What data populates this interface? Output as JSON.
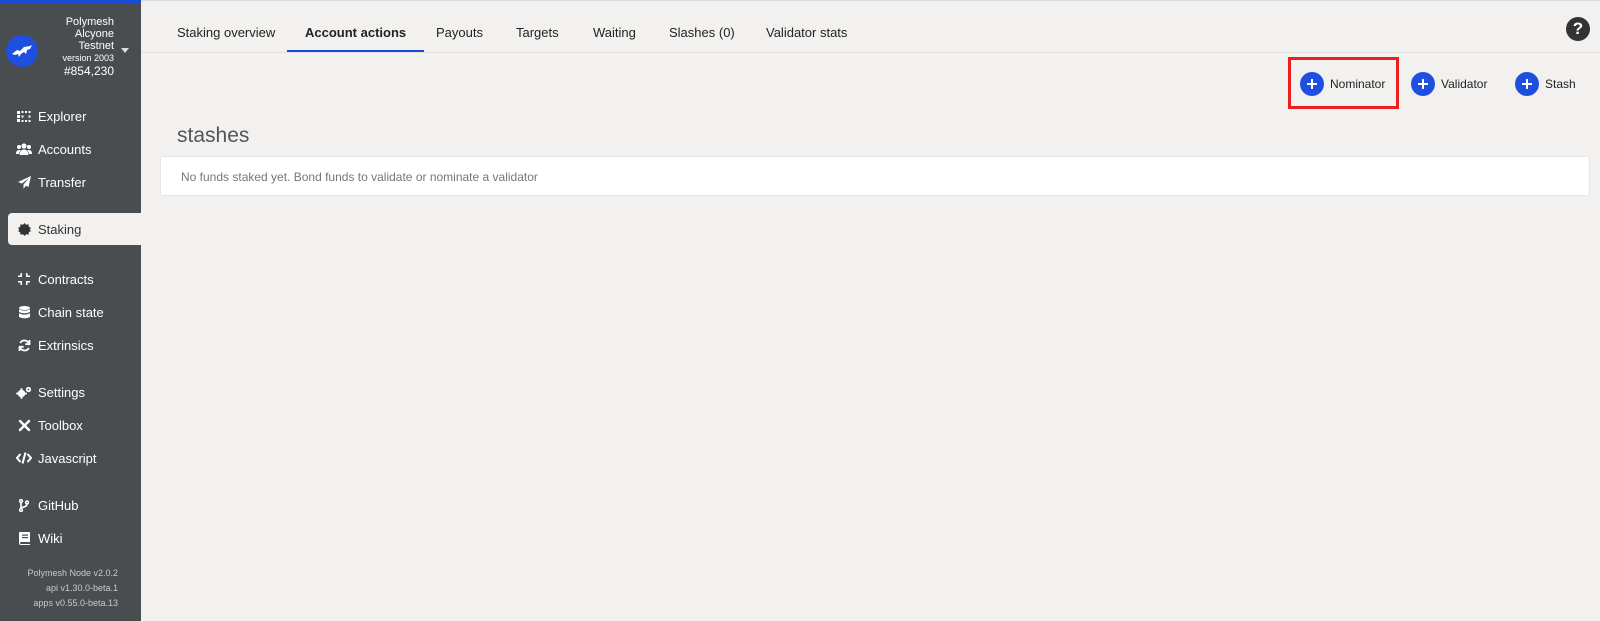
{
  "chain": {
    "name_line1": "Polymesh",
    "name_line2": "Alcyone",
    "name_line3": "Testnet",
    "version": "version 2003",
    "block": "#854,230"
  },
  "sidebar": {
    "items": [
      {
        "label": "Explorer",
        "icon": "explorer-grid-icon"
      },
      {
        "label": "Accounts",
        "icon": "users-icon"
      },
      {
        "label": "Transfer",
        "icon": "paper-plane-icon"
      },
      {
        "label": "Staking",
        "icon": "certificate-icon",
        "active": true
      },
      {
        "label": "Contracts",
        "icon": "compress-icon"
      },
      {
        "label": "Chain state",
        "icon": "database-icon"
      },
      {
        "label": "Extrinsics",
        "icon": "sync-icon"
      },
      {
        "label": "Settings",
        "icon": "cogs-icon"
      },
      {
        "label": "Toolbox",
        "icon": "tools-icon"
      },
      {
        "label": "Javascript",
        "icon": "code-icon"
      },
      {
        "label": "GitHub",
        "icon": "code-branch-icon"
      },
      {
        "label": "Wiki",
        "icon": "book-icon"
      }
    ],
    "footer": {
      "node": "Polymesh Node v2.0.2",
      "api": "api v1.30.0-beta.1",
      "apps": "apps v0.55.0-beta.13"
    }
  },
  "tabs": [
    {
      "label": "Staking overview"
    },
    {
      "label": "Account actions",
      "active": true
    },
    {
      "label": "Payouts"
    },
    {
      "label": "Targets"
    },
    {
      "label": "Waiting"
    },
    {
      "label": "Slashes (0)"
    },
    {
      "label": "Validator stats"
    }
  ],
  "help": {
    "icon": "question-circle-icon",
    "glyph": "?"
  },
  "actions": {
    "nominator": "Nominator",
    "validator": "Validator",
    "stash": "Stash"
  },
  "content": {
    "section_title": "stashes",
    "empty_message": "No funds staked yet. Bond funds to validate or nominate a validator"
  },
  "colors": {
    "accent": "#1f4fdf",
    "sidebar_bg": "#4a4d50",
    "page_bg": "#f2f1ef",
    "highlight": "#ee1e1e"
  }
}
